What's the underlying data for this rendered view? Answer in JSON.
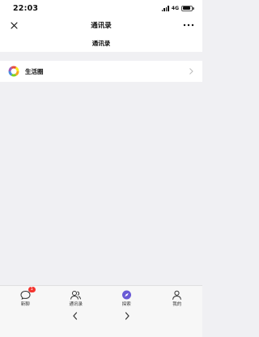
{
  "status": {
    "time": "22:03",
    "network": "4G",
    "battery_level": 0.85
  },
  "nav": {
    "title": "通讯录",
    "close_icon": "close-icon",
    "more_icon": "more-icon"
  },
  "sub_header": {
    "title": "通讯录"
  },
  "list": {
    "items": [
      {
        "label": "生活圈",
        "icon": "colorful-ring-icon"
      }
    ]
  },
  "tabs": [
    {
      "label": "新聊",
      "icon": "chat-bubble-icon",
      "badge": "1"
    },
    {
      "label": "通讯录",
      "icon": "contacts-icon"
    },
    {
      "label": "探索",
      "icon": "compass-icon"
    },
    {
      "label": "我的",
      "icon": "person-icon"
    }
  ],
  "browser": {
    "back_icon": "chevron-left-icon",
    "forward_icon": "chevron-right-icon"
  },
  "colors": {
    "accent": "#6a5bd6",
    "badge": "#f43530",
    "background": "#f0f0f3"
  }
}
